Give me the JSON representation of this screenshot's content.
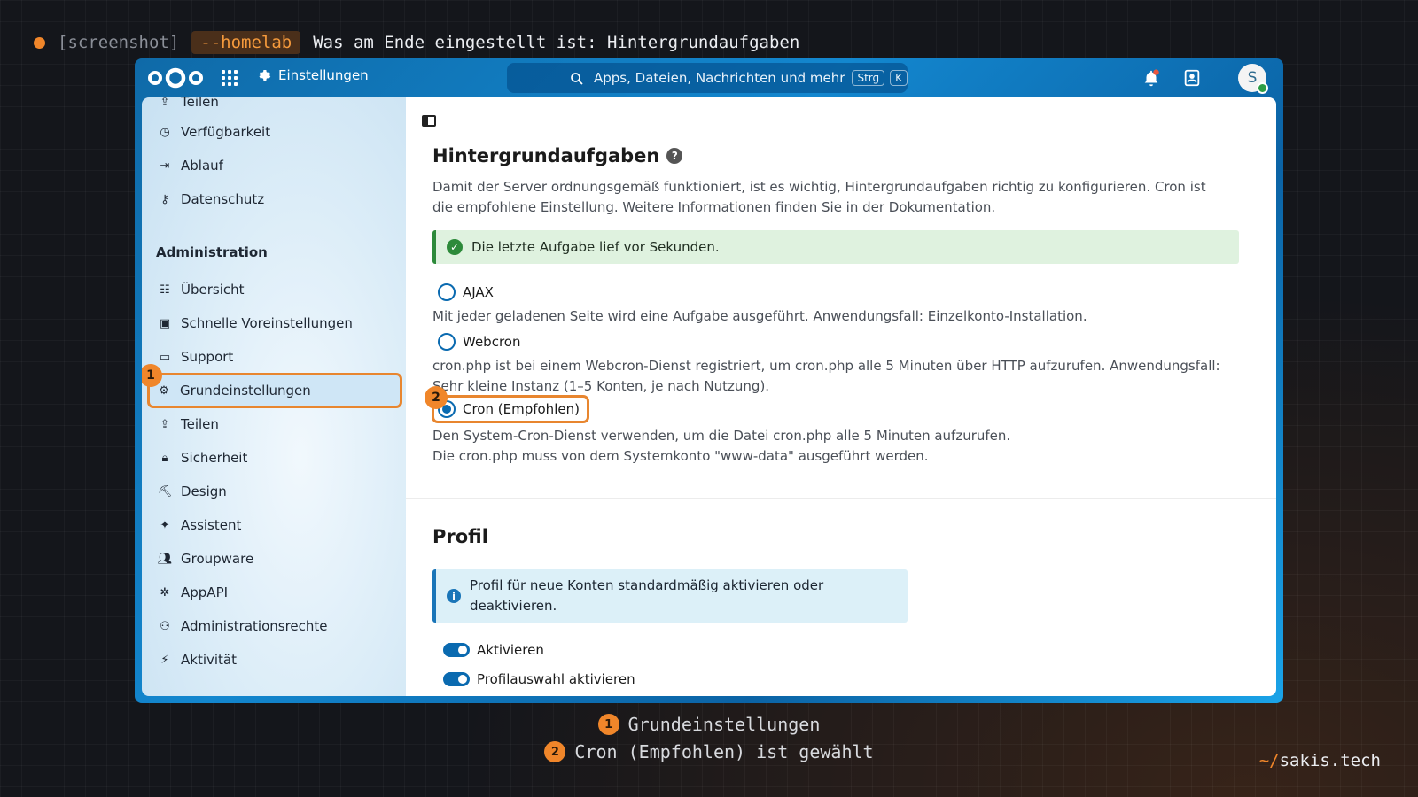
{
  "caption": {
    "tag": "[screenshot]",
    "pill": "--homelab",
    "title": "Was am Ende eingestellt ist: Hintergrundaufgaben"
  },
  "topbar": {
    "settings_label": "Einstellungen",
    "search_placeholder": "Apps, Dateien, Nachrichten und mehr",
    "kbd1": "Strg",
    "kbd2": "K",
    "avatar_letter": "S"
  },
  "sidebar": {
    "partial_item": "Teilen",
    "personal_items": [
      "Verfügbarkeit",
      "Ablauf",
      "Datenschutz"
    ],
    "section_title": "Administration",
    "admin_items": [
      "Übersicht",
      "Schnelle Voreinstellungen",
      "Support",
      "Grundeinstellungen",
      "Teilen",
      "Sicherheit",
      "Design",
      "Assistent",
      "Groupware",
      "AppAPI",
      "Administrationsrechte",
      "Aktivität"
    ],
    "badge_1": "1"
  },
  "background_jobs": {
    "title": "Hintergrundaufgaben",
    "help": "?",
    "description": "Damit der Server ordnungsgemäß funktioniert, ist es wichtig, Hintergrundaufgaben richtig zu konfigurieren. Cron ist die empfohlene Einstellung. Weitere Informationen finden Sie in der Dokumentation.",
    "status": "Die letzte Aufgabe lief vor Sekunden.",
    "ajax_label": "AJAX",
    "ajax_desc": "Mit jeder geladenen Seite wird eine Aufgabe ausgeführt. Anwendungsfall: Einzelkonto-Installation.",
    "webcron_label": "Webcron",
    "webcron_desc": "cron.php ist bei einem Webcron-Dienst registriert, um cron.php alle 5 Minuten über HTTP aufzurufen. Anwendungsfall: Sehr kleine Instanz (1–5 Konten, je nach Nutzung).",
    "cron_label": "Cron (Empfohlen)",
    "cron_desc_1": "Den System-Cron-Dienst verwenden, um die Datei cron.php alle 5 Minuten aufzurufen.",
    "cron_desc_2": "Die cron.php muss von dem Systemkonto \"www-data\" ausgeführt werden.",
    "badge_2": "2"
  },
  "profile": {
    "title": "Profil",
    "info": "Profil für neue Konten standardmäßig aktivieren oder deaktivieren.",
    "toggle_1": "Aktivieren",
    "toggle_2": "Profilauswahl aktivieren"
  },
  "footer": {
    "note_1_num": "1",
    "note_1": "Grundeinstellungen",
    "note_2_num": "2",
    "note_2": "Cron (Empfohlen) ist gewählt",
    "brand_prefix": "~/",
    "brand": "sakis.tech"
  },
  "colors": {
    "accent": "#f0862a",
    "nextcloud_blue": "#0a6ab0",
    "success": "#2d8a3a"
  }
}
